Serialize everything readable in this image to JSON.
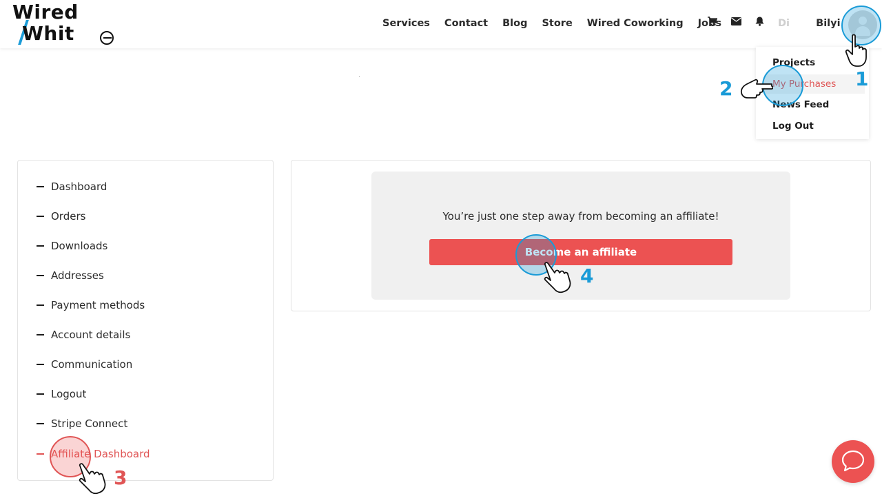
{
  "header": {
    "logo": {
      "line1": "Wired",
      "line2": "Whit"
    },
    "nav": [
      "Services",
      "Contact",
      "Blog",
      "Store",
      "Wired Coworking",
      "Jobs"
    ],
    "icons": [
      "cart-icon",
      "envelope-icon",
      "bell-icon"
    ],
    "user_name_blurred": "Di",
    "user_name": "Bilyi"
  },
  "dropdown": {
    "items": [
      {
        "label": "Projects"
      },
      {
        "label": "My Purchases",
        "active": true
      },
      {
        "label": "News Feed"
      },
      {
        "label": "Log Out"
      }
    ]
  },
  "sidebar": {
    "items": [
      {
        "label": "Dashboard"
      },
      {
        "label": "Orders"
      },
      {
        "label": "Downloads"
      },
      {
        "label": "Addresses"
      },
      {
        "label": "Payment methods"
      },
      {
        "label": "Account details"
      },
      {
        "label": "Communication"
      },
      {
        "label": "Logout"
      },
      {
        "label": "Stripe Connect"
      },
      {
        "label": "Affiliate Dashboard",
        "active": true
      }
    ]
  },
  "content": {
    "notice": "You’re just one step away from becoming an affiliate!",
    "button": "Become an affiliate"
  },
  "annotations": {
    "steps": [
      "1",
      "2",
      "3",
      "4"
    ],
    "colors": {
      "blue": "#1a9bd7",
      "red": "#e05555"
    }
  },
  "colors": {
    "accent": "#ec5252",
    "text": "#2b2b2b"
  }
}
